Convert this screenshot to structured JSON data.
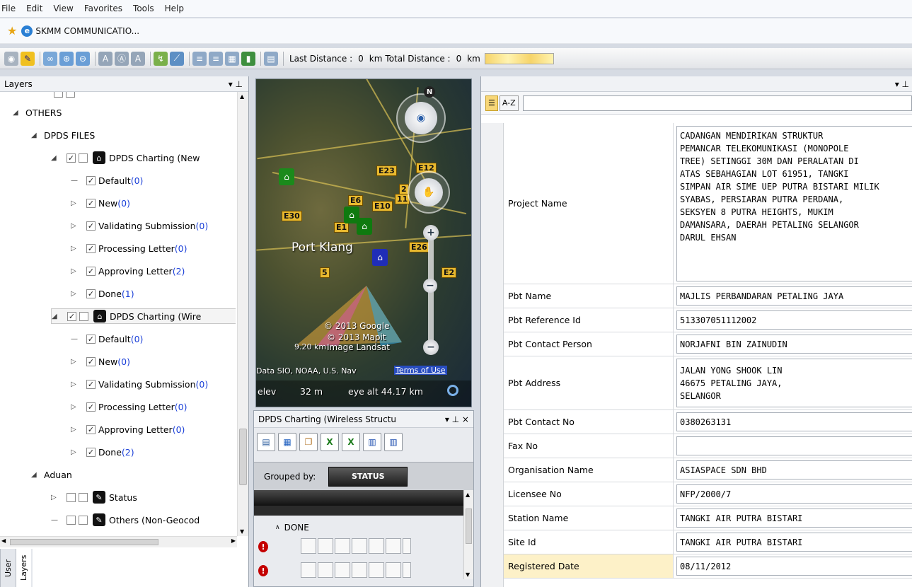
{
  "menu": [
    "File",
    "Edit",
    "View",
    "Favorites",
    "Tools",
    "Help"
  ],
  "favorites": {
    "tab_title": "SKMM COMMUNICATIO..."
  },
  "toolbar": {
    "last_distance_label": "Last Distance :",
    "last_distance_value": "0",
    "unit1": "km",
    "total_distance_label": "Total Distance :",
    "total_distance_value": "0",
    "unit2": "km"
  },
  "layers_panel": {
    "title": "Layers",
    "pin": "▾  ⊥",
    "tree": [
      {
        "label": "OTHERS",
        "count": ""
      },
      {
        "label": "DPDS FILES",
        "count": ""
      },
      {
        "label": "DPDS Charting (New",
        "count": ""
      },
      {
        "label": "Default",
        "count": "(0)"
      },
      {
        "label": "New",
        "count": "(0)"
      },
      {
        "label": "Validating Submission",
        "count": "(0)"
      },
      {
        "label": "Processing Letter ",
        "count": "(0)"
      },
      {
        "label": "Approving Letter",
        "count": "(2)"
      },
      {
        "label": "Done",
        "count": "(1)"
      },
      {
        "label": "DPDS Charting (Wire",
        "count": ""
      },
      {
        "label": "Default",
        "count": "(0)"
      },
      {
        "label": "New",
        "count": "(0)"
      },
      {
        "label": "Validating Submission",
        "count": "(0)"
      },
      {
        "label": "Processing Letter",
        "count": "(0)"
      },
      {
        "label": "Approving Letter",
        "count": "(0)"
      },
      {
        "label": "Done",
        "count": "(2)"
      },
      {
        "label": "Aduan",
        "count": ""
      },
      {
        "label": "Status",
        "count": ""
      },
      {
        "label": "Others (Non-Geocod",
        "count": ""
      }
    ],
    "side_tabs": [
      "User",
      "Layers"
    ]
  },
  "map": {
    "place": "Port Klang",
    "compass": "N",
    "copyright1": "© 2013 Google",
    "copyright2": "© 2013 Mapit",
    "image_credit": "Image Landsat",
    "data_credit": "Data SIO, NOAA, U.S. Nav",
    "terms": "Terms of Use",
    "scale": "9.20 km",
    "elev_label": "elev",
    "elev_value": "32 m",
    "eye_alt": "eye alt  44.17 km",
    "highways": [
      "E23",
      "E12",
      "E6",
      "E10",
      "E30",
      "E1",
      "E26",
      "E2",
      "5",
      "2",
      "11"
    ]
  },
  "dpds_panel": {
    "title": "DPDS Charting (Wireless Structu",
    "controls": "▾  ⊥  ×",
    "grouped_by_label": "Grouped by:",
    "group_value": "STATUS",
    "group_row": "DONE"
  },
  "properties": {
    "pin": "▾  ⊥",
    "sort_az": "A-Z",
    "rows": [
      {
        "name": "Project Name",
        "value": "CADANGAN MENDIRIKAN STRUKTUR\nPEMANCAR TELEKOMUNIKASI (MONOPOLE\nTREE) SETINGGI 30M DAN PERALATAN DI\nATAS SEBAHAGIAN LOT 61951, TANGKI\nSIMPAN AIR SIME UEP PUTRA BISTARI MILIK\nSYABAS, PERSIARAN PUTRA PERDANA,\nSEKSYEN 8 PUTRA HEIGHTS,  MUKIM\nDAMANSARA, DAERAH PETALING SELANGOR\nDARUL EHSAN"
      },
      {
        "name": "Pbt Name",
        "value": "MAJLIS PERBANDARAN PETALING JAYA"
      },
      {
        "name": "Pbt Reference Id",
        "value": "513307051112002"
      },
      {
        "name": "Pbt Contact Person",
        "value": "NORJAFNI BIN ZAINUDIN"
      },
      {
        "name": "Pbt Address",
        "value": "JALAN YONG SHOOK LIN\n46675 PETALING JAYA,\nSELANGOR"
      },
      {
        "name": "Pbt Contact No",
        "value": "0380263131"
      },
      {
        "name": "Fax No",
        "value": ""
      },
      {
        "name": "Organisation Name",
        "value": "ASIASPACE SDN BHD"
      },
      {
        "name": "Licensee No",
        "value": "NFP/2000/7"
      },
      {
        "name": "Station Name",
        "value": "TANGKI AIR PUTRA BISTARI"
      },
      {
        "name": "Site Id",
        "value": "TANGKI AIR PUTRA BISTARI"
      },
      {
        "name": "Registered Date",
        "value": "08/11/2012"
      }
    ]
  },
  "colors": {
    "count_blue": "#1a3fd8",
    "highlight": "#fdf1c8",
    "alert_red": "#c40000"
  }
}
